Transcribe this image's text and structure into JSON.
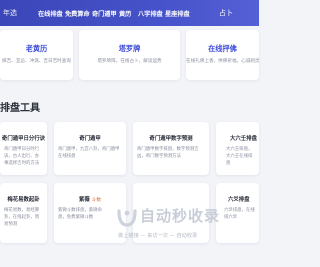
{
  "nav": {
    "brand": "年选",
    "items": [
      "在线排盘",
      "免费算命",
      "奇门遁甲",
      "黄历",
      "八字排盘",
      "星座排盘"
    ],
    "more": "占卜"
  },
  "features": [
    {
      "title": "老黄历",
      "desc": "择吉、宜忌、冲煞、吉日吉时查询"
    },
    {
      "title": "塔罗牌",
      "desc": "塔罗牌阵，在线占卜，解读运势"
    },
    {
      "title": "在线抨佛",
      "desc": "在线礼佛上香，供佛祈福，心诚则灵"
    }
  ],
  "section": {
    "title": "排盘工具"
  },
  "tools_row1": [
    {
      "title": "奇门遁甲日分行诀",
      "desc": "奇门遁甲日分时行诀，古人出行、办事选择吉时的方法"
    },
    {
      "title": "奇门遁甲",
      "desc": "奇门遁甲，九宫八卦，奇门遁甲在线排盘"
    },
    {
      "title": "奇门遁甲数字预测",
      "desc": "奇门遁甲数字排盘，数字预测吉凶，奇门数字预测方法"
    },
    {
      "title": "大六壬排盘",
      "desc": "大六壬排盘，大六壬在线排盘"
    }
  ],
  "tools_row2": [
    {
      "title": "梅花易数起卦",
      "desc": "梅花易数，易经算卦，在线起卦，周易预测"
    },
    {
      "title": "紫薇",
      "badge": "斗数",
      "desc": "紫微斗数排盘，紫微命盘，免费紫微斗数"
    },
    {
      "title": "",
      "desc": ""
    },
    {
      "title": "六爻排盘",
      "desc": "六爻排盘，在线排六爻"
    }
  ],
  "watermark": {
    "name": "自动秒收录",
    "sub": "做上链接 — 来访一次 — 自动收录"
  },
  "colors": {
    "nav_bg": "#3b46b8",
    "accent": "#3c4ad6",
    "page_bg": "#f2f4f8"
  }
}
